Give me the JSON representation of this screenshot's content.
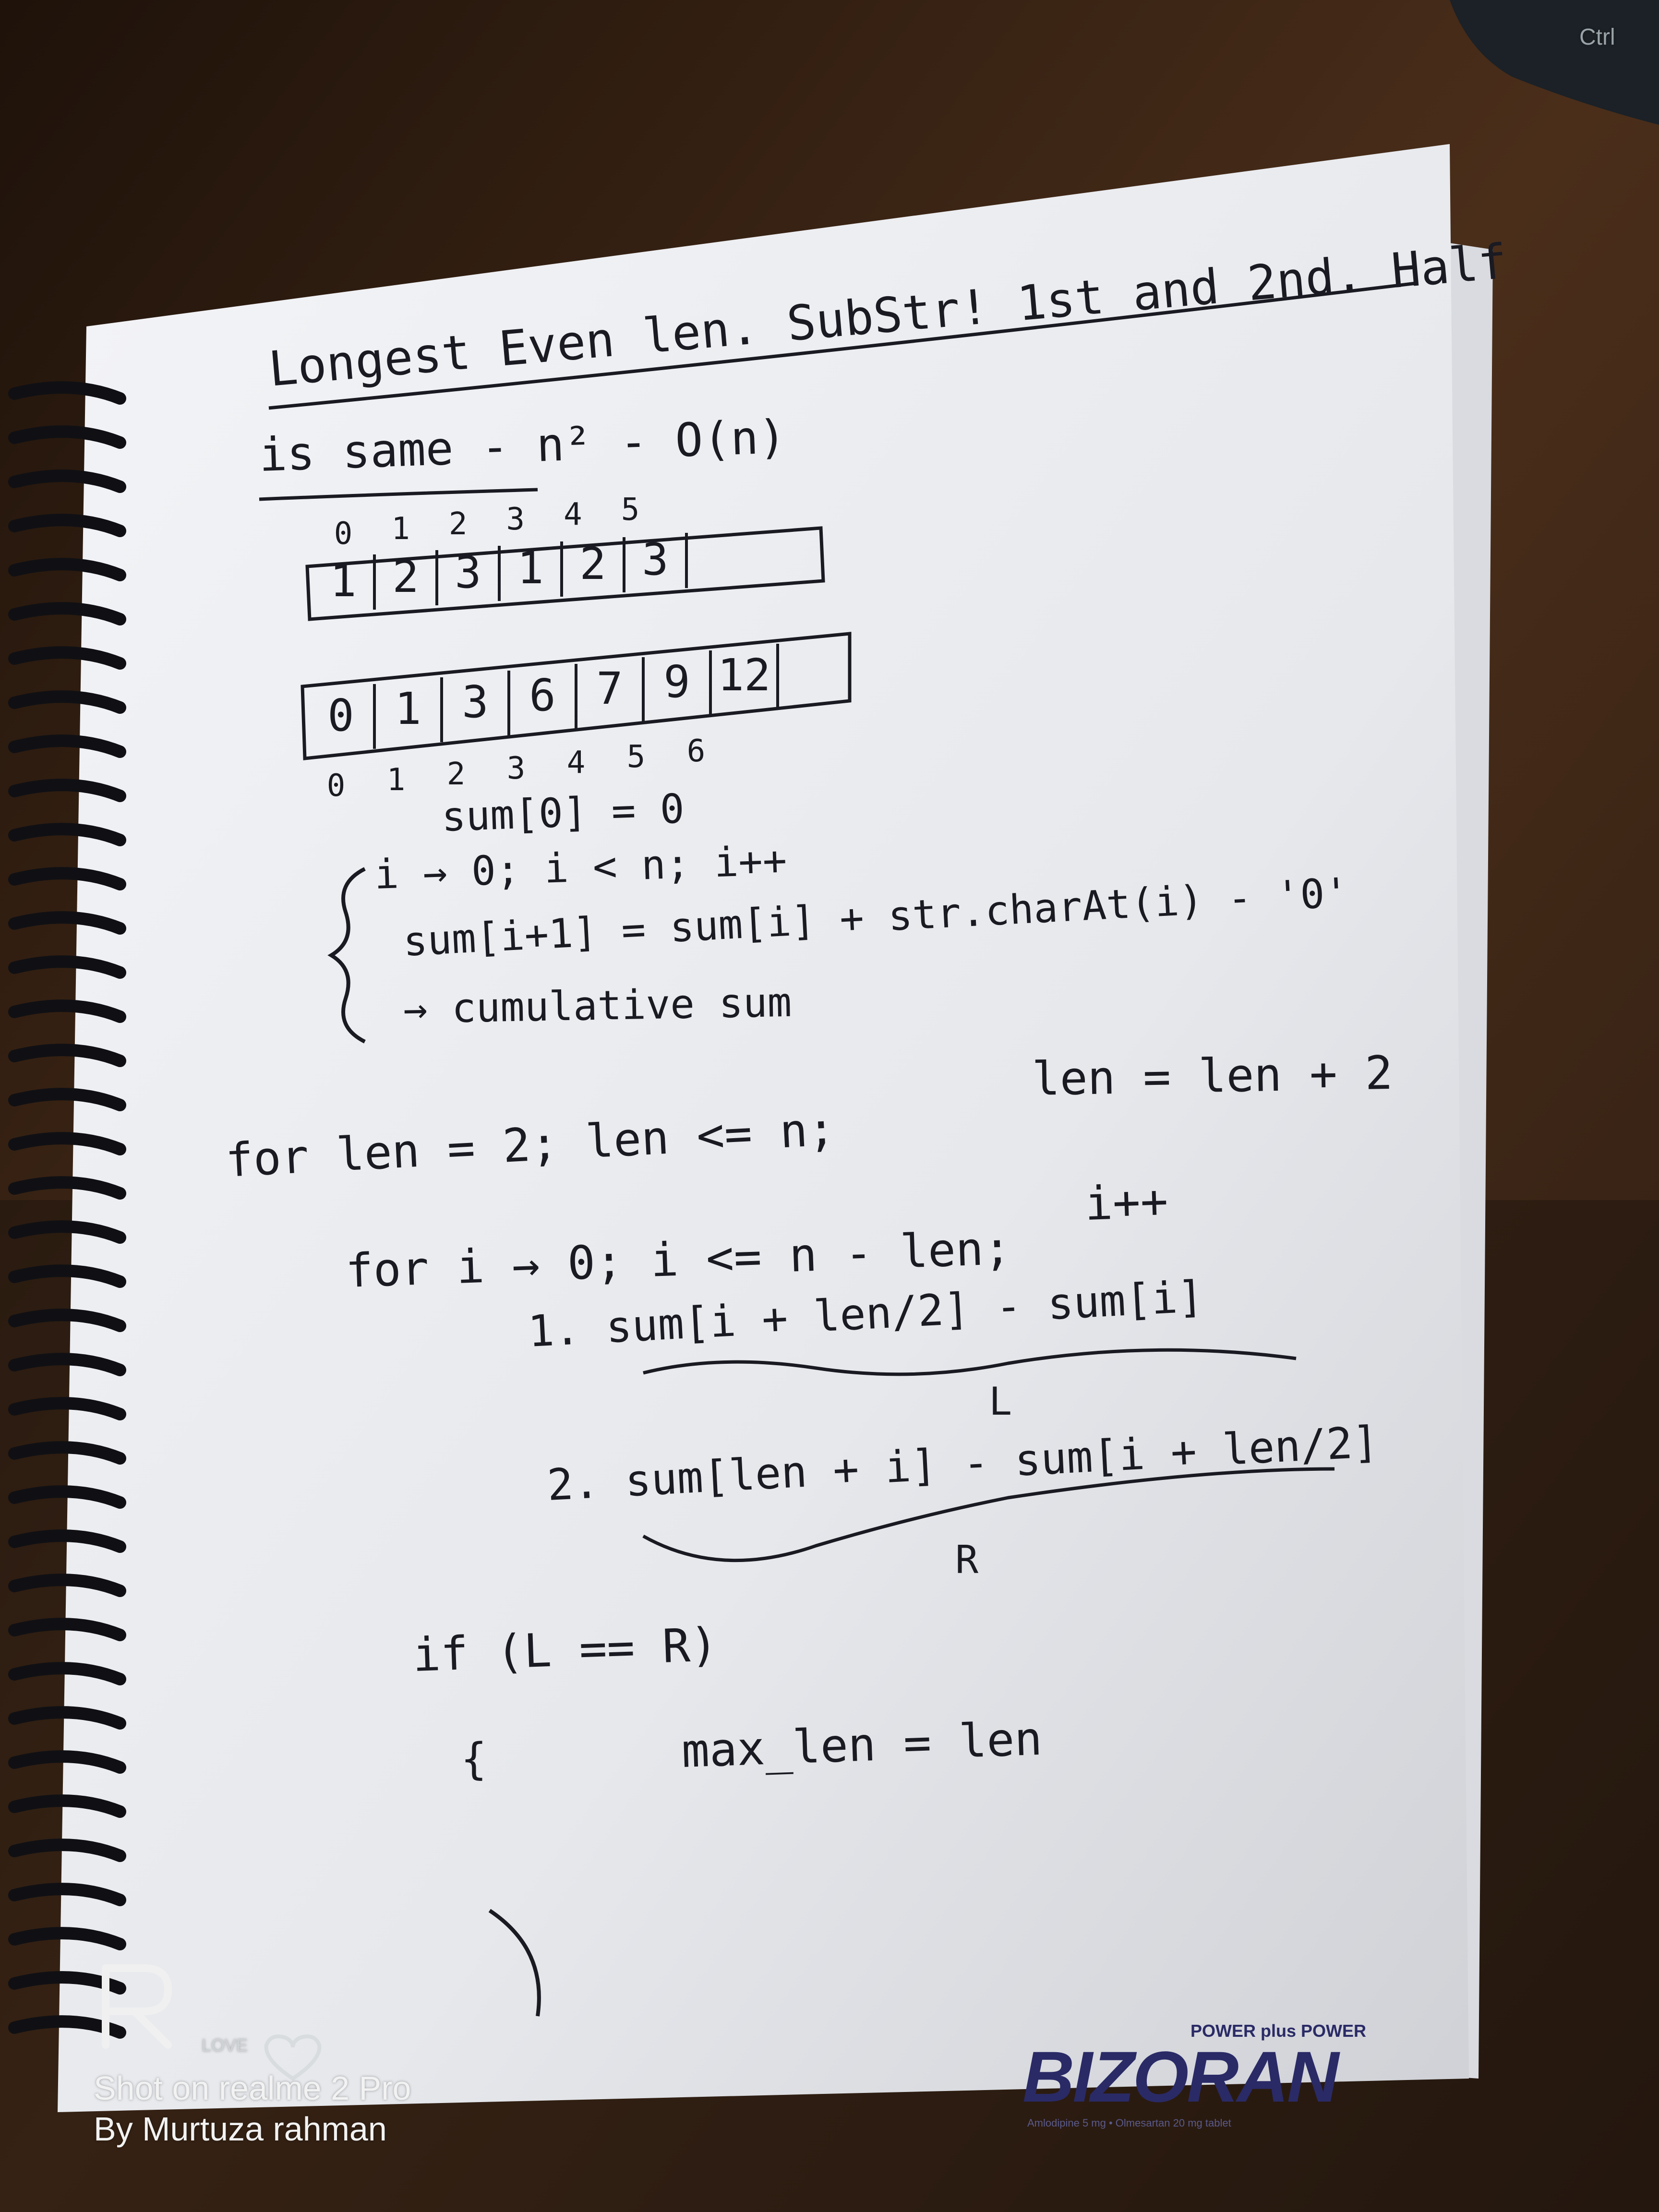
{
  "image": {
    "title_line1": "Longest Even len. SubStr! 1st and 2nd. Half",
    "title_line2": "is same - n² - O(n)"
  },
  "array1": {
    "indices": [
      "0",
      "1",
      "2",
      "3",
      "4",
      "5"
    ],
    "cells": [
      "1",
      "2",
      "3",
      "1",
      "2",
      "3"
    ]
  },
  "array2": {
    "cells": [
      "0",
      "1",
      "3",
      "6",
      "7",
      "9",
      "12"
    ],
    "indices": [
      "0",
      "1",
      "2",
      "3",
      "4",
      "5",
      "6"
    ]
  },
  "code": {
    "line1": "sum[0] = 0",
    "line2": "i → 0; i < n; i++",
    "line3": "sum[i+1] = sum[i] + str.charAt(i) - '0'",
    "line4": "→ cumulative sum",
    "line5a": "for len = 2; len <= n;",
    "line5b": "len = len + 2",
    "line6": "i++",
    "line7": "for i → 0; i <= n - len;",
    "line8": "1. sum[i + len/2] - sum[i]",
    "label_l": "L",
    "line9": "2. sum[len + i] - sum[i + len/2]",
    "label_r": "R",
    "line10": "if (L == R)",
    "line11_brace": "{",
    "line11": "max_len = len",
    "close_brace": "}"
  },
  "overlays": {
    "device_key": "Ctrl",
    "love": "LOVE",
    "shot_on": "Shot on realme 2 Pro",
    "by": "By Murtuza rahman",
    "brand_slogan": "POWER plus POWER",
    "brand_name": "BIZORAN",
    "brand_fine": "Amlodipine 5 mg • Olmesartan 20 mg tablet"
  },
  "colors": {
    "desk": "#3a2416",
    "paper": "#eceef2",
    "ink": "#1a1a22",
    "brand": "#2a2a66"
  }
}
